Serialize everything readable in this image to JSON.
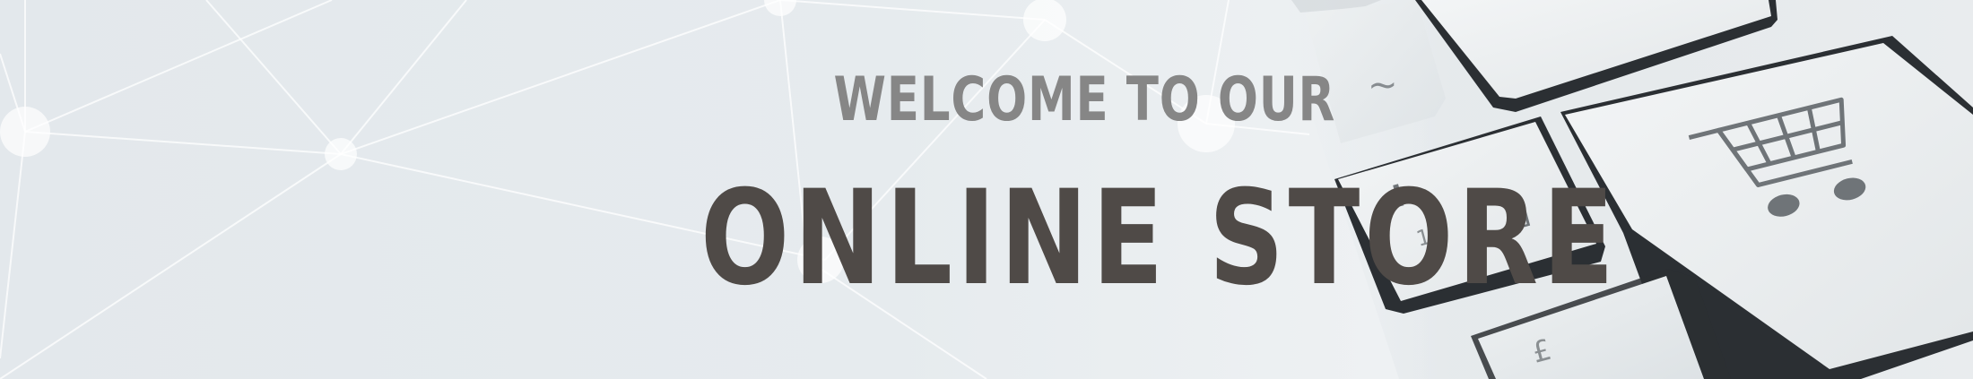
{
  "banner": {
    "welcome_text": "WELCOME TO OUR",
    "title_text": "ONLINE STORE"
  },
  "icons": {
    "cart": "shopping-cart-icon",
    "network": "network-pattern"
  },
  "colors": {
    "background": "#e6ebee",
    "welcome_text": "#868686",
    "title_text": "#4f4a47",
    "key_face": "#eef0f1",
    "key_shadow": "#2b2f33"
  }
}
